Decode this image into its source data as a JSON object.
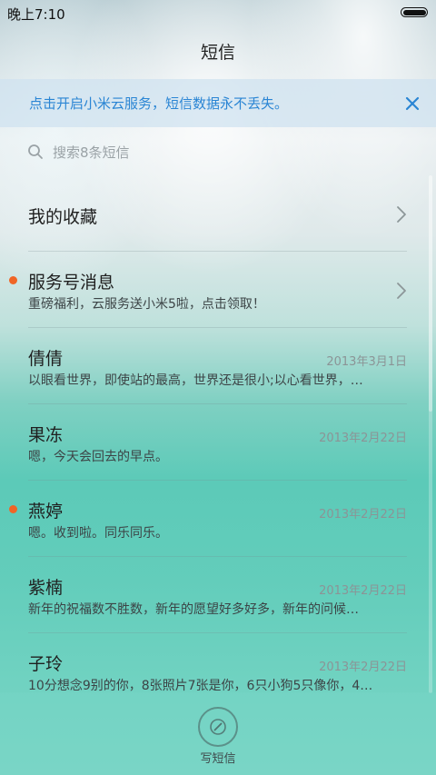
{
  "status": {
    "time": "晚上7:10"
  },
  "header": {
    "title": "短信"
  },
  "banner": {
    "text": "点击开启小米云服务，短信数据永不丢失。",
    "close_icon": "close-icon",
    "accent": "#2a85d4"
  },
  "search": {
    "placeholder": "搜索8条短信"
  },
  "threads": [
    {
      "name": "我的收藏",
      "preview": "",
      "date": "",
      "unread": false,
      "chevron": true
    },
    {
      "name": "服务号消息",
      "preview": "重磅福利，云服务送小米5啦，点击领取！",
      "date": "",
      "unread": true,
      "chevron": true
    },
    {
      "name": "倩倩",
      "preview": "以眼看世界，即使站的最高，世界还是很小;以心看世界，…",
      "date": "2013年3月1日",
      "unread": false,
      "chevron": false
    },
    {
      "name": "果冻",
      "preview": "嗯，今天会回去的早点。",
      "date": "2013年2月22日",
      "unread": false,
      "chevron": false
    },
    {
      "name": "燕婷",
      "preview": "嗯。收到啦。同乐同乐。",
      "date": "2013年2月22日",
      "unread": true,
      "chevron": false
    },
    {
      "name": "紫楠",
      "preview": "新年的祝福数不胜数，新年的愿望好多好多，新年的问候…",
      "date": "2013年2月22日",
      "unread": false,
      "chevron": false
    },
    {
      "name": "子玲",
      "preview": "10分想念9别的你，8张照片7张是你，6只小狗5只像你，4…",
      "date": "2013年2月22日",
      "unread": false,
      "chevron": false
    }
  ],
  "compose": {
    "label": "写短信",
    "icon": "compose-icon"
  },
  "colors": {
    "unread_dot": "#f06526"
  }
}
